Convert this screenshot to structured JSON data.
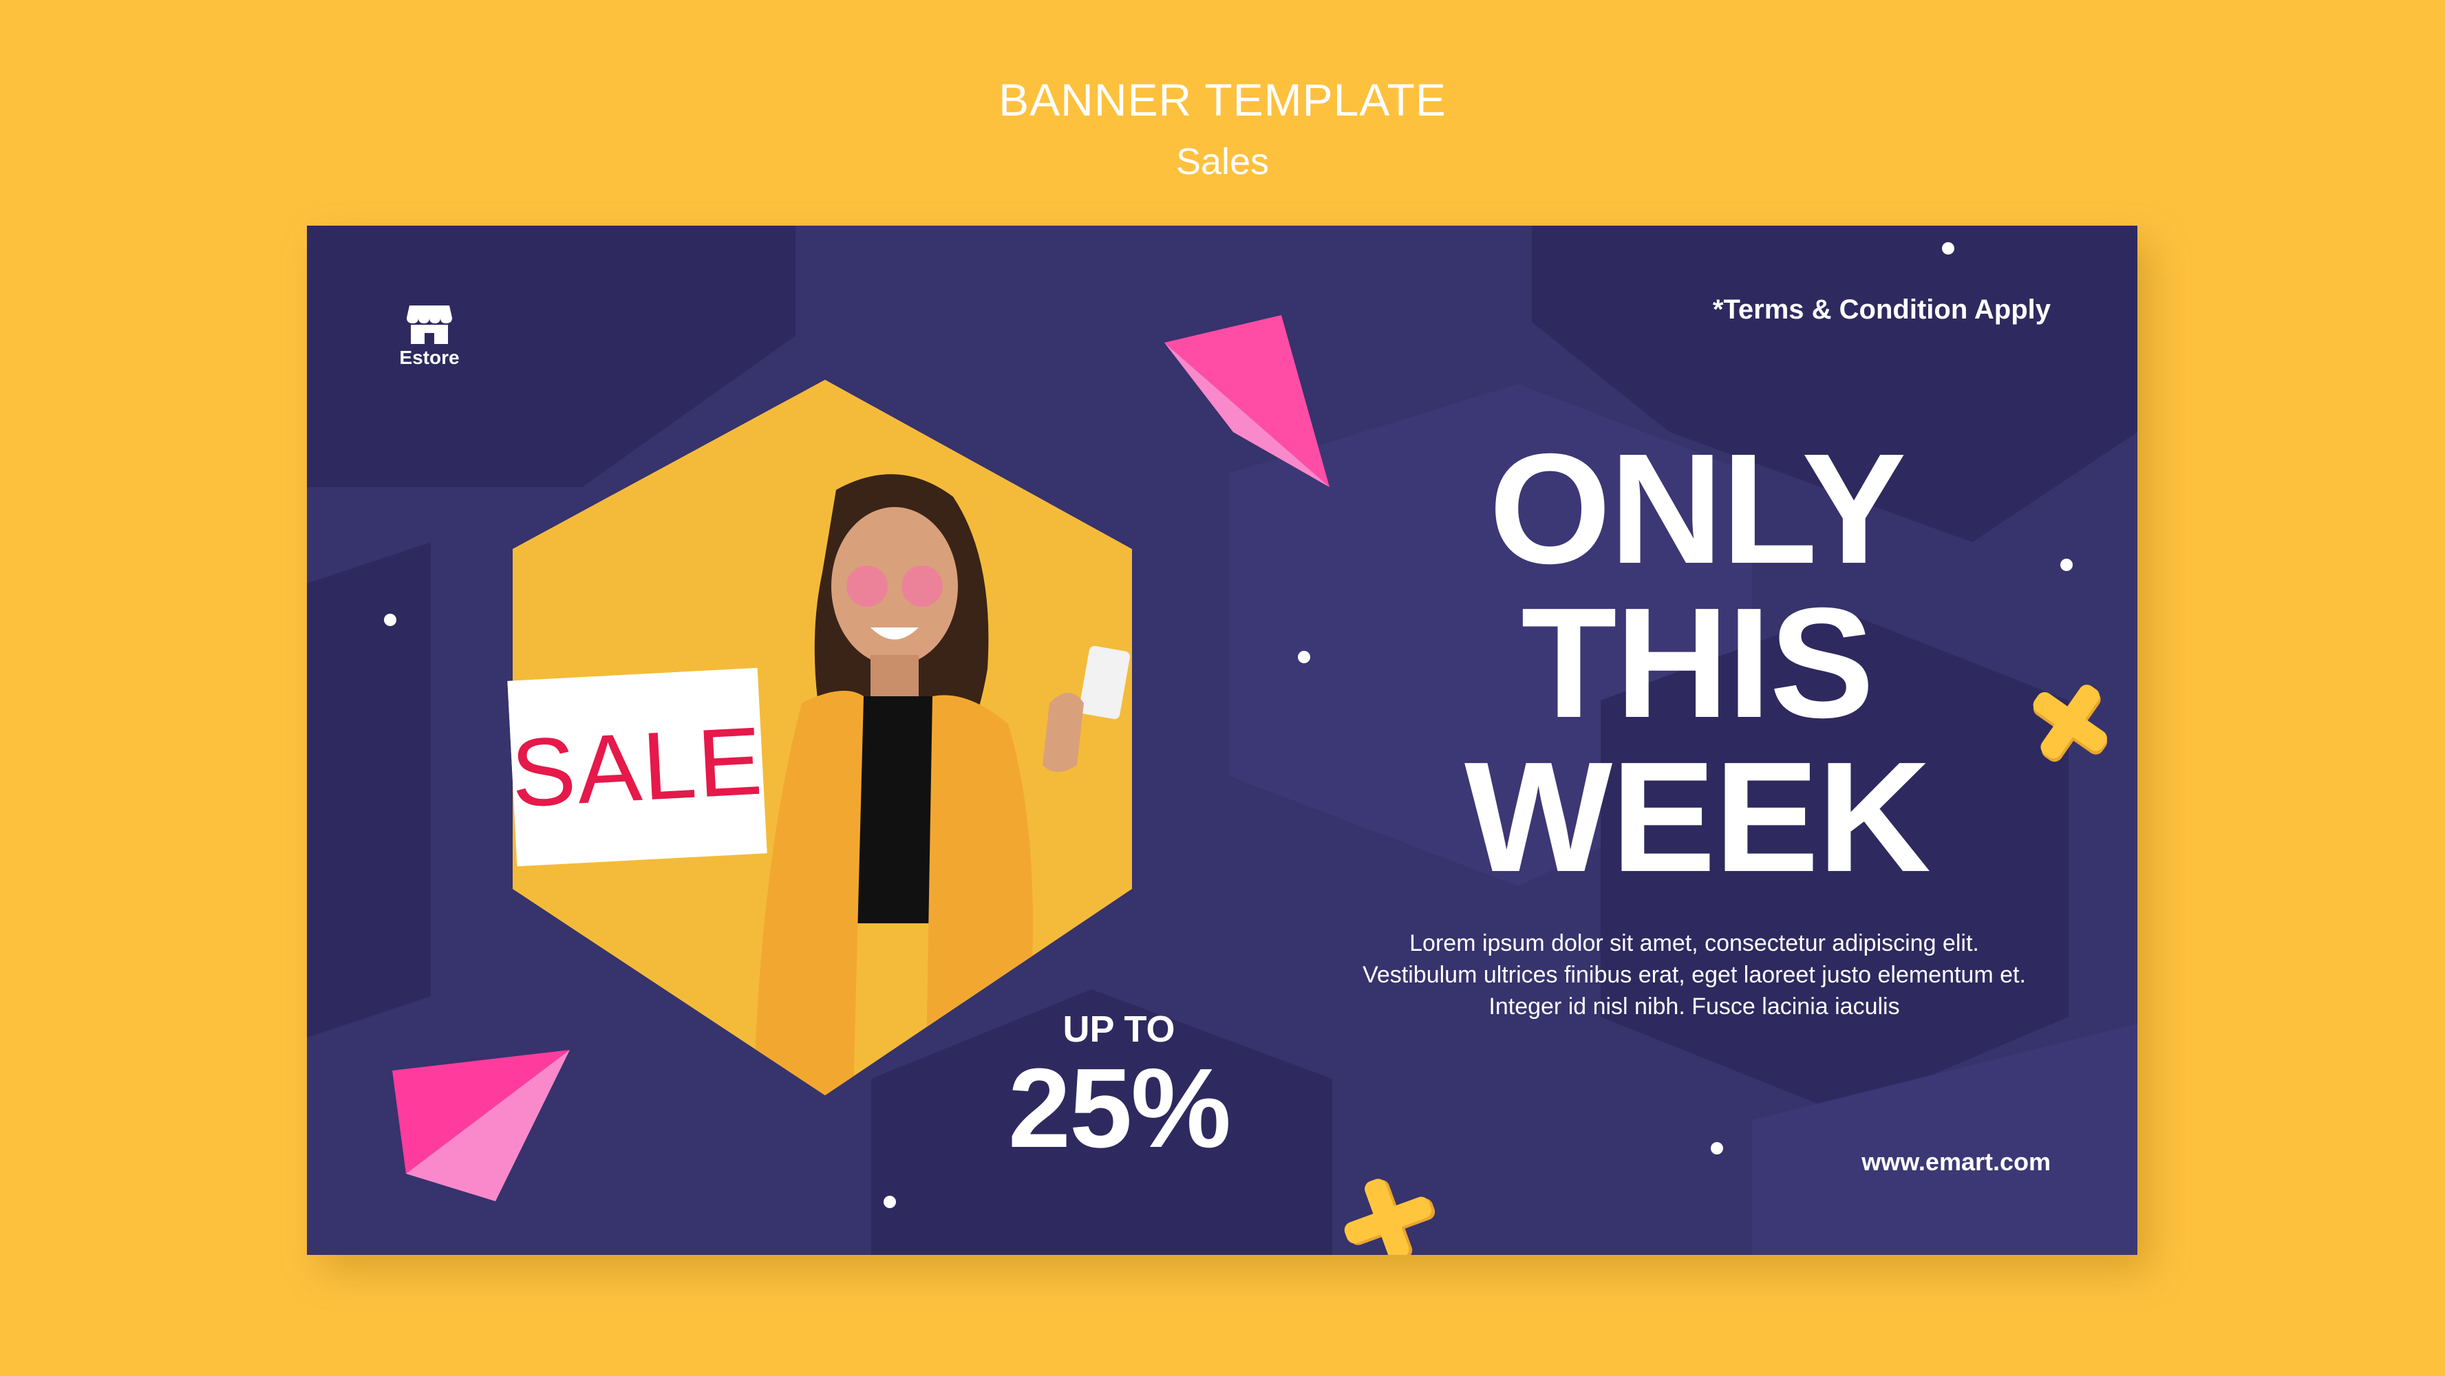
{
  "header": {
    "title": "BANNER TEMPLATE",
    "subtitle": "Sales"
  },
  "banner": {
    "logo_label": "Estore",
    "terms": "*Terms & Condition Apply",
    "headline": [
      "ONLY",
      "THIS",
      "WEEK"
    ],
    "body": "Lorem ipsum dolor sit amet, consectetur adipiscing elit. Vestibulum ultrices finibus erat, eget laoreet justo elementum et. Integer id nisl nibh. Fusce lacinia iaculis",
    "discount_prefix": "UP TO",
    "discount_value": "25%",
    "website": "www.emart.com",
    "photo_sign_text": "SALE"
  },
  "colors": {
    "page_background": "#FEC13E",
    "banner_background": "#37336C",
    "hexagon_darker": "#2E2A5F",
    "hexagon_lighter": "#3C3875",
    "accent_pink": "#FF4DA6",
    "accent_yellow": "#FFC53D",
    "text": "#FFFFFF",
    "sale_red": "#E5194A"
  },
  "icons": [
    "store-icon",
    "pink-triangle-shape",
    "yellow-cross-shape"
  ]
}
